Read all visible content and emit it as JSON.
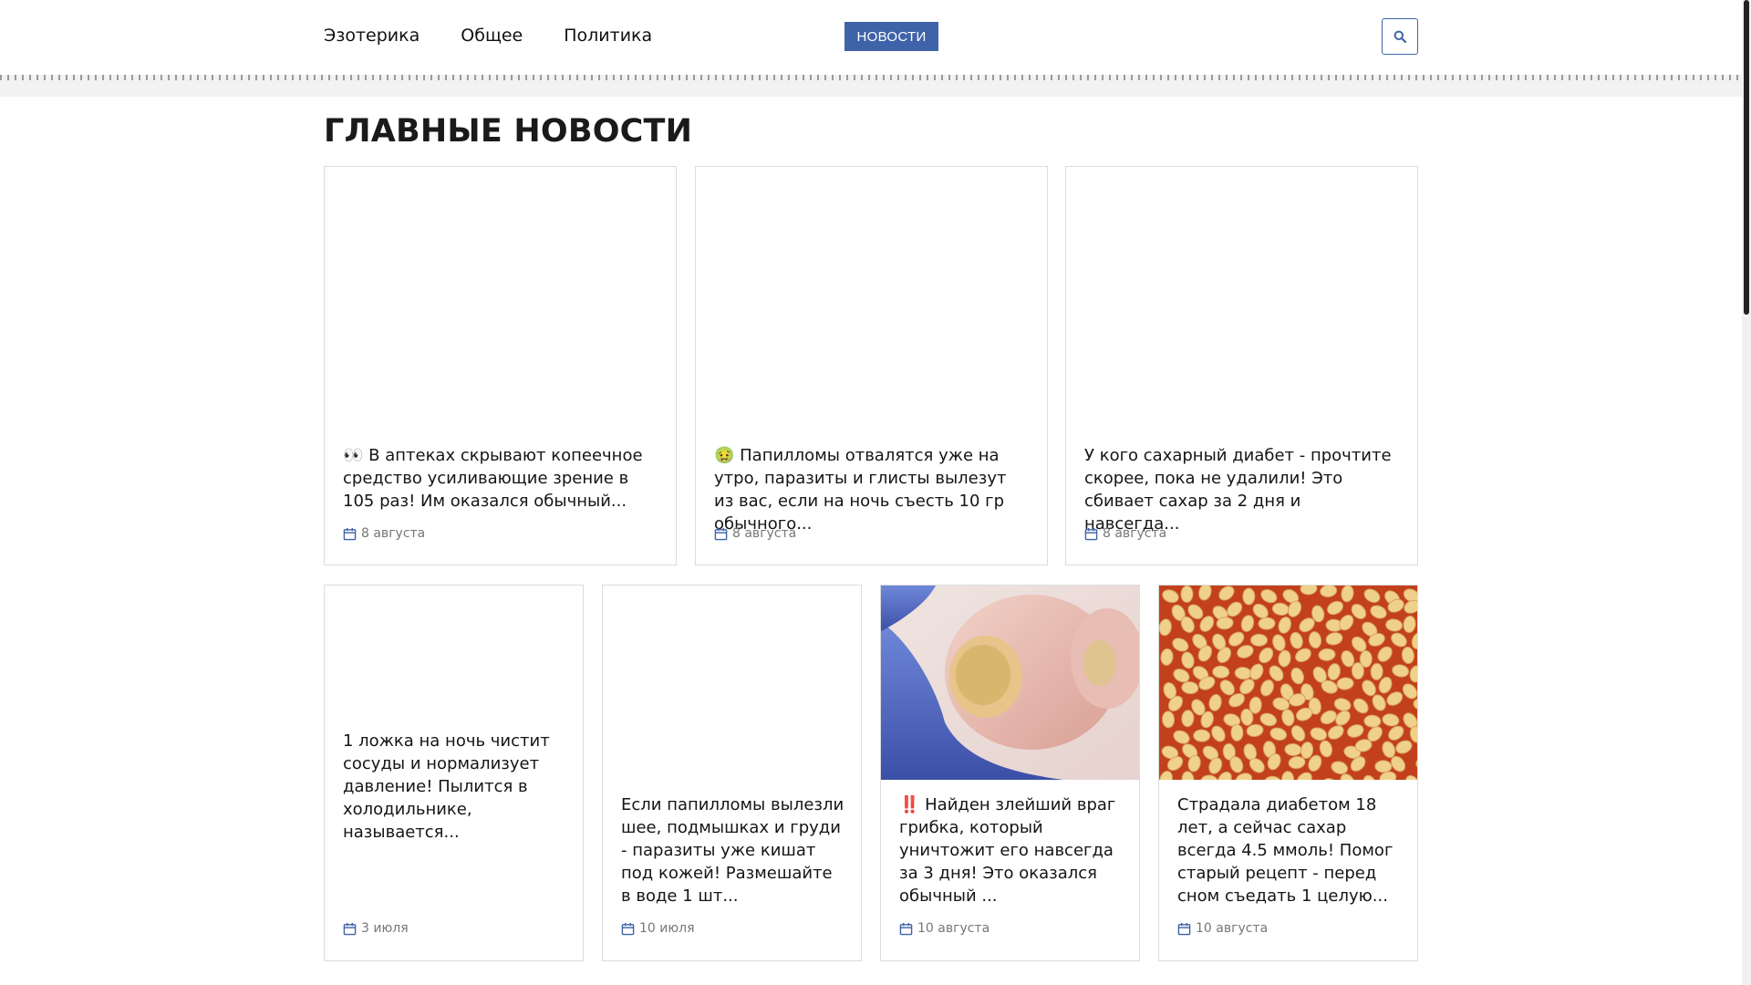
{
  "nav": {
    "items": [
      {
        "label": "Эзотерика"
      },
      {
        "label": "Общее"
      },
      {
        "label": "Политика"
      }
    ],
    "news_button": "НОВОСТИ",
    "search_icon": "search-icon"
  },
  "section": {
    "title": "ГЛАВНЫЕ НОВОСТИ"
  },
  "colors": {
    "accent": "#3f63a8",
    "date_text": "#777777"
  },
  "cards": [
    {
      "title": "👀 В аптеках скрывают копеечное средство усиливающие зрение в 105 раз! Им оказался обычный...",
      "date": "8 августа"
    },
    {
      "title": "🤢 Папилломы отвалятся уже на утро, паразиты и глисты вылезут из вас, если на ночь съесть 10 гр обычного...",
      "date": "8 августа"
    },
    {
      "title": "У кого сахарный диабет - прочтите скорее, пока не удалили! Это сбивает сахар за 2 дня и навсегда...",
      "date": "8 августа"
    },
    {
      "title": "1 ложка на ночь чистит сосуды и нормализует давление! Пылится в холодильнике, называется...",
      "date": "3 июля"
    },
    {
      "title": "Если папилломы вылезли шее, подмышках и груди - паразиты уже кишат под кожей! Размешайте в воде 1 шт...",
      "date": "10 июля"
    },
    {
      "title": "‼️ Найден злейший враг грибка, который уничтожит его навсегда за 3 дня! Это оказался обычный ...",
      "date": "10 августа"
    },
    {
      "title": "Страдала диабетом 18 лет, а сейчас сахар всегда 4.5 ммоль! Помог старый рецепт - перед сном съедать 1 целую...",
      "date": "10 августа"
    }
  ]
}
